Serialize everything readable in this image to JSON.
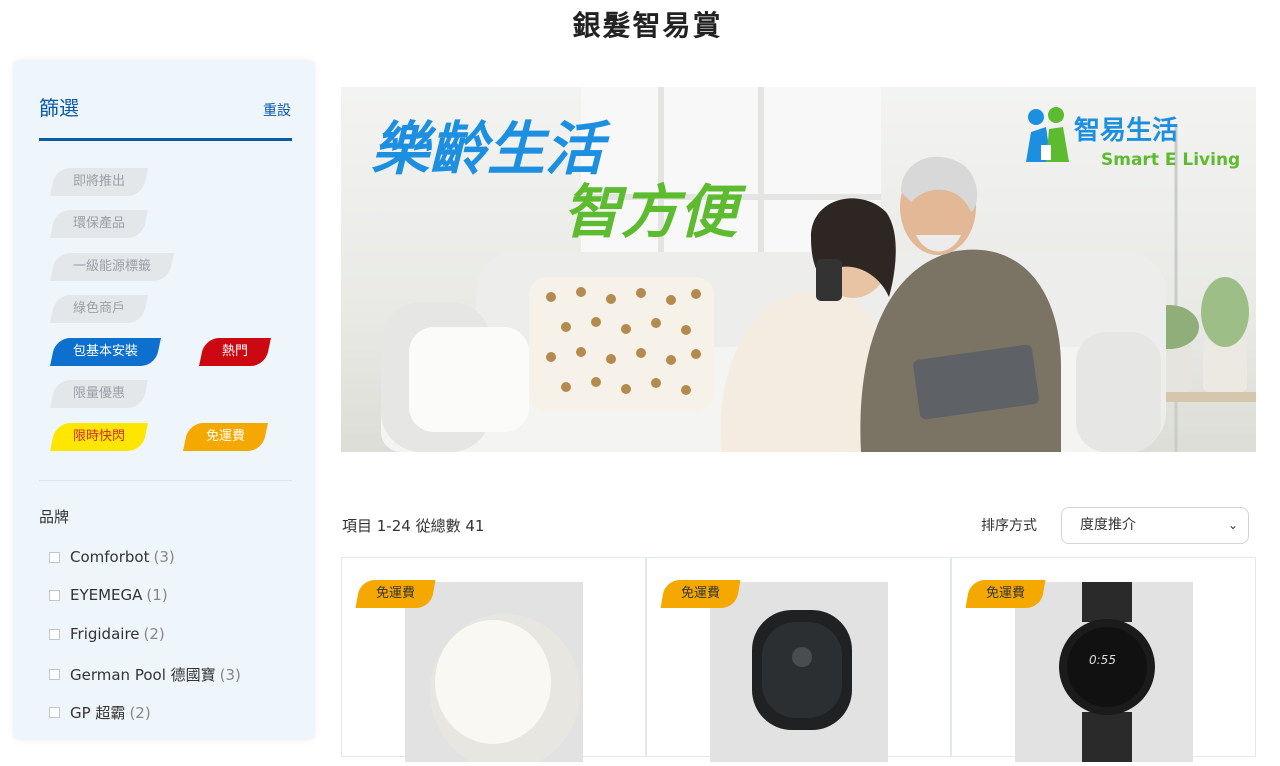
{
  "page": {
    "title": "銀髮智易賞"
  },
  "sidebar": {
    "title": "篩選",
    "reset": "重設",
    "tags": [
      {
        "label": "即將推出",
        "style": "grey"
      },
      {
        "label": "環保產品",
        "style": "grey"
      },
      {
        "label": "一級能源標籤",
        "style": "grey"
      },
      {
        "label": "綠色商戶",
        "style": "grey"
      },
      {
        "label": "包基本安裝",
        "style": "blue"
      },
      {
        "label": "熱門",
        "style": "red"
      },
      {
        "label": "限量優惠",
        "style": "grey"
      },
      {
        "label": "限時快閃",
        "style": "yellow"
      },
      {
        "label": "免運費",
        "style": "orange"
      }
    ],
    "brand_heading": "品牌",
    "brands": [
      {
        "name": "Comforbot",
        "count": "(3)"
      },
      {
        "name": "EYEMEGA",
        "count": "(1)"
      },
      {
        "name": "Frigidaire",
        "count": "(2)"
      },
      {
        "name": "German Pool 德國寶",
        "count": "(3)"
      },
      {
        "name": "GP 超霸",
        "count": "(2)"
      }
    ]
  },
  "banner": {
    "headline_1": "樂齡生活",
    "headline_2": "智方便",
    "logo_cn": "智易生活",
    "logo_en": "Smart E Living"
  },
  "listing": {
    "count_text": "項目 1-24 從總數 41",
    "sort_label": "排序方式",
    "sort_value": "度度推介"
  },
  "products": [
    {
      "badge": "免運費",
      "image": "smart-light-image"
    },
    {
      "badge": "免運費",
      "image": "gps-tracker-image"
    },
    {
      "badge": "免運費",
      "image": "smart-watch-image"
    }
  ],
  "colors": {
    "primary": "#0a5aa8",
    "blue_tag": "#0d6fce",
    "red_tag": "#cc0812",
    "yellow_tag": "#ffe600",
    "orange_tag": "#f5a800",
    "banner_blue": "#1d8fe0",
    "banner_green": "#5dbb2f"
  }
}
